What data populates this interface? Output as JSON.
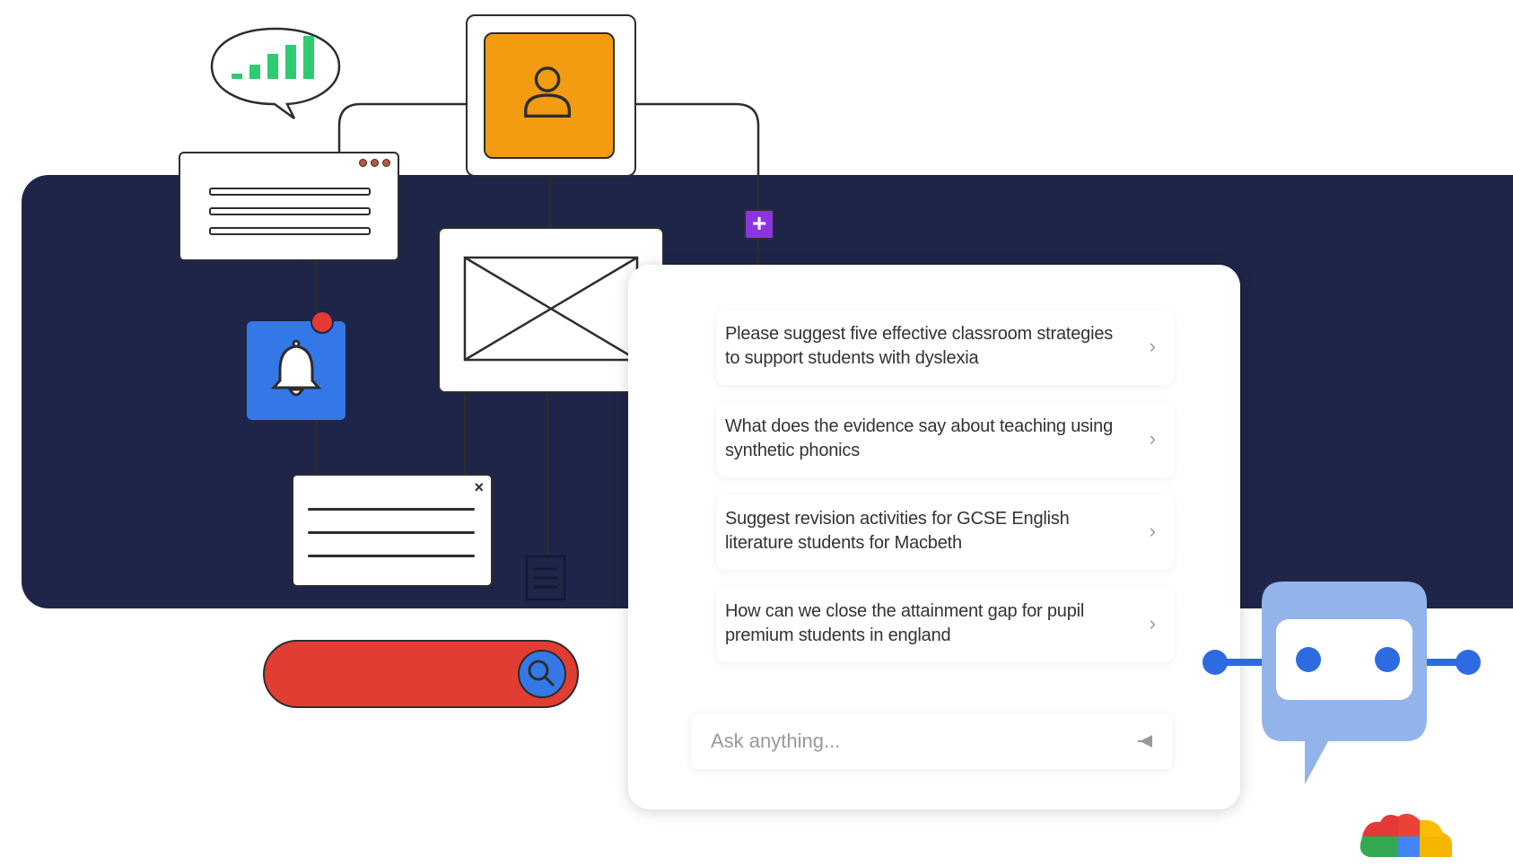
{
  "colors": {
    "navy": "#1e2548",
    "accent_orange": "#f39c12",
    "accent_blue": "#3478e8",
    "accent_red": "#e23d32",
    "accent_purple": "#8b35e0",
    "signal_green": "#2ecc71",
    "bot_blue": "#93b4ea"
  },
  "icons": {
    "signal": "signal-bars-icon",
    "user": "user-icon",
    "bell": "bell-icon",
    "image": "image-placeholder-icon",
    "close": "close-icon",
    "search": "search-icon",
    "plus": "plus-icon",
    "send": "send-icon",
    "chevron": "chevron-right-icon",
    "bot": "chatbot-icon",
    "logo": "cloud-logo-icon"
  },
  "dialog": {
    "close_label": "×"
  },
  "plus_label": "+",
  "chat": {
    "suggestions": [
      {
        "text": "Please suggest five effective classroom strategies to support students with dyslexia",
        "chevron": "›"
      },
      {
        "text": "What does the evidence say about teaching using synthetic phonics",
        "chevron": "›"
      },
      {
        "text": "Suggest revision activities for GCSE English literature students for Macbeth",
        "chevron": "›"
      },
      {
        "text": "How can we close the attainment gap for pupil premium students in england",
        "chevron": "›"
      }
    ],
    "input": {
      "placeholder": "Ask anything..."
    }
  }
}
